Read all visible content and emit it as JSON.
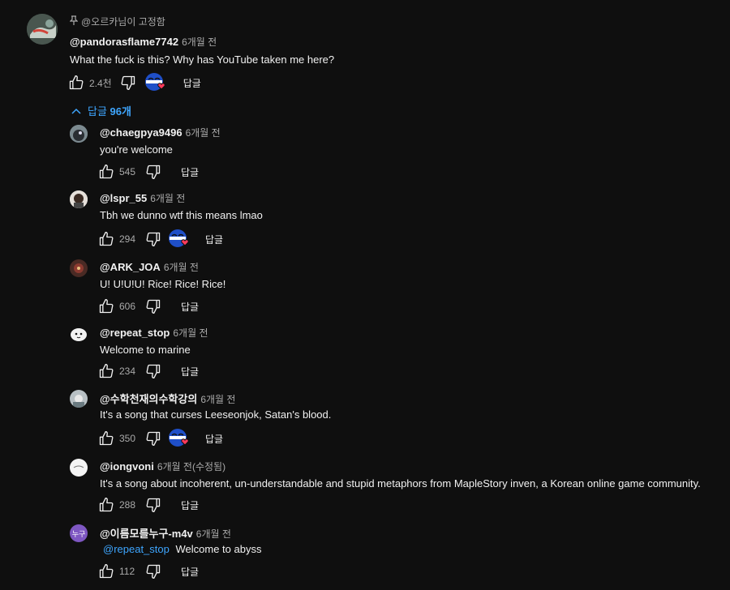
{
  "colors": {
    "background": "#0f0f0f",
    "link": "#3ea6ff",
    "muted": "#aaaaaa",
    "text": "#f1f1f1",
    "heart": "#ff3b5c"
  },
  "top_comment": {
    "pinned_label": "@오르카님이 고정함",
    "pin_icon": "pin-icon",
    "author": "@pandorasflame7742",
    "time": "6개월 전",
    "text": "What the fuck is this? Why has YouTube taken me here?",
    "likes": "2.4천",
    "reply_label": "답글"
  },
  "replies_toggle": {
    "label": "답글",
    "count": "96개",
    "icon": "chevron-up-icon"
  },
  "replies": [
    {
      "author": "@chaegpya9496",
      "time": "6개월 전",
      "text": "you're welcome",
      "likes": "545",
      "hearted": false,
      "reply_label": "답글"
    },
    {
      "author": "@lspr_55",
      "time": "6개월 전",
      "text": "Tbh we dunno wtf this means lmao",
      "likes": "294",
      "hearted": true,
      "reply_label": "답글"
    },
    {
      "author": "@ARK_JOA",
      "time": "6개월 전",
      "text": "U! U!U!U! Rice! Rice! Rice!",
      "likes": "606",
      "hearted": false,
      "reply_label": "답글"
    },
    {
      "author": "@repeat_stop",
      "time": "6개월 전",
      "text": "Welcome to marine",
      "likes": "234",
      "hearted": false,
      "reply_label": "답글"
    },
    {
      "author": "@수학천재의수학강의",
      "time": "6개월 전",
      "text": "It's a song that curses Leeseonjok, Satan's blood.",
      "likes": "350",
      "hearted": true,
      "reply_label": "답글"
    },
    {
      "author": "@iongvoni",
      "time": "6개월 전(수정됨)",
      "text": "It's a song about incoherent, un-understandable and stupid metaphors from MapleStory inven, a Korean online game community.",
      "likes": "288",
      "hearted": false,
      "reply_label": "답글"
    },
    {
      "author": "@이름모를누구-m4v",
      "time": "6개월 전",
      "mention": "@repeat_stop",
      "text": "Welcome to abyss",
      "likes": "112",
      "hearted": false,
      "reply_label": "답글",
      "avatar_text": "누구"
    }
  ]
}
